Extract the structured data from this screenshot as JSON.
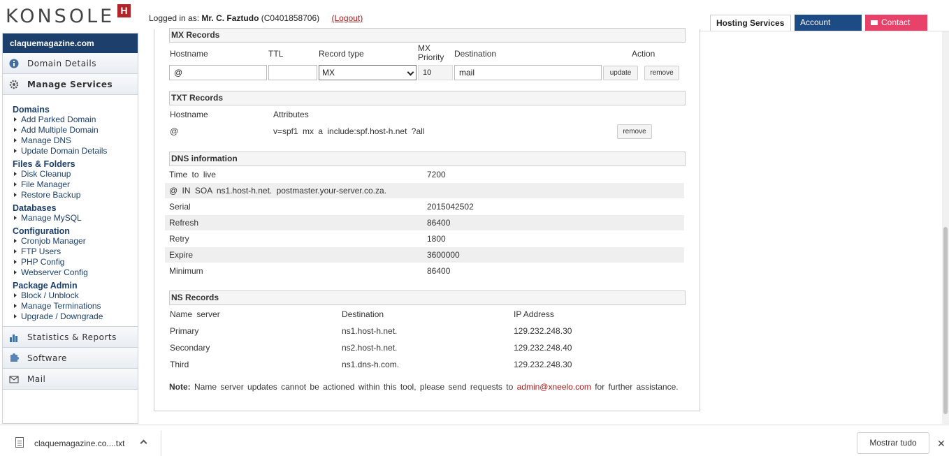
{
  "header": {
    "logo_text": "KONSOLE",
    "logo_badge": "H",
    "logged_in_label": "Logged in as:",
    "user_name": "Mr. C. Faztudo",
    "user_id": "(C0401858706)",
    "logout": "(Logout)",
    "tabs": {
      "hosting": "Hosting Services",
      "account": "Account Admin",
      "contact": "Contact Us"
    }
  },
  "sidebar": {
    "site_name": "claquemagazine.com",
    "sections": {
      "domain_details": "Domain Details",
      "manage_services": "Manage Services",
      "statistics": "Statistics & Reports",
      "software": "Software",
      "mail": "Mail"
    },
    "groups": [
      {
        "title": "Domains",
        "items": [
          "Add Parked Domain",
          "Add Multiple Domain",
          "Manage DNS",
          "Update Domain Details"
        ]
      },
      {
        "title": "Files & Folders",
        "items": [
          "Disk Cleanup",
          "File Manager",
          "Restore Backup"
        ]
      },
      {
        "title": "Databases",
        "items": [
          "Manage MySQL"
        ]
      },
      {
        "title": "Configuration",
        "items": [
          "Cronjob Manager",
          "FTP Users",
          "PHP Config",
          "Webserver Config"
        ]
      },
      {
        "title": "Package Admin",
        "items": [
          "Block / Unblock",
          "Manage Terminations",
          "Upgrade / Downgrade"
        ]
      }
    ]
  },
  "mx": {
    "title": "MX Records",
    "cols": {
      "hostname": "Hostname",
      "ttl": "TTL",
      "type": "Record type",
      "priority": "MX Priority",
      "destination": "Destination",
      "action": "Action"
    },
    "row": {
      "hostname": "@",
      "ttl": "",
      "type": "MX",
      "priority": "10",
      "destination": "mail",
      "update": "update",
      "remove": "remove"
    }
  },
  "txt": {
    "title": "TXT Records",
    "cols": {
      "hostname": "Hostname",
      "attributes": "Attributes"
    },
    "row": {
      "hostname": "@",
      "attributes": "v=spf1 mx a include:spf.host-h.net ?all",
      "remove": "remove"
    }
  },
  "dns": {
    "title": "DNS information",
    "ttl_label": "Time to live",
    "ttl_value": "7200",
    "soa": "@ IN SOA ns1.host-h.net. postmaster.your-server.co.za.",
    "rows": [
      {
        "label": "Serial",
        "value": "2015042502"
      },
      {
        "label": "Refresh",
        "value": "86400"
      },
      {
        "label": "Retry",
        "value": "1800"
      },
      {
        "label": "Expire",
        "value": "3600000"
      },
      {
        "label": "Minimum",
        "value": "86400"
      }
    ]
  },
  "ns": {
    "title": "NS Records",
    "cols": {
      "name": "Name server",
      "destination": "Destination",
      "ip": "IP Address"
    },
    "rows": [
      {
        "name": "Primary",
        "destination": "ns1.host-h.net.",
        "ip": "129.232.248.30"
      },
      {
        "name": "Secondary",
        "destination": "ns2.host-h.net.",
        "ip": "129.232.248.40"
      },
      {
        "name": "Third",
        "destination": "ns1.dns-h.com.",
        "ip": "129.232.248.30"
      }
    ]
  },
  "note": {
    "label": "Note:",
    "text": "Name server updates cannot be actioned within this tool, please send requests to",
    "email": "admin@xneelo.com",
    "suffix": "for further assistance."
  },
  "download_bar": {
    "file_name": "claquemagazine.co....txt",
    "show_all": "Mostrar tudo",
    "close": "✕"
  },
  "colors": {
    "navy": "#1c3f6b",
    "account_btn": "#1d4b85",
    "contact_btn": "#e8416a",
    "logo_red": "#b1252a",
    "link_red": "#a11a1a"
  }
}
